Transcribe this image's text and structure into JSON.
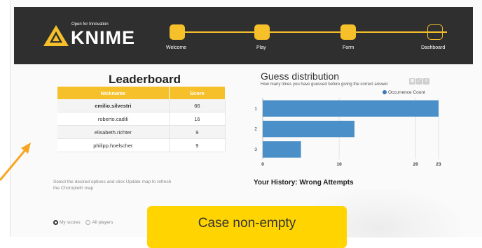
{
  "header": {
    "logo_tagline": "Open for Innovation",
    "logo_wordmark": "KNIME",
    "steps": [
      {
        "label": "Welcome",
        "state": "completed"
      },
      {
        "label": "Play",
        "state": "completed"
      },
      {
        "label": "Form",
        "state": "completed"
      },
      {
        "label": "Dashboard",
        "state": "current"
      }
    ]
  },
  "leaderboard": {
    "title": "Leaderboard",
    "columns": [
      "Nickname",
      "Score"
    ],
    "rows": [
      {
        "nickname": "emilio.silvestri",
        "score": "66"
      },
      {
        "nickname": "roberto.cadili",
        "score": "16"
      },
      {
        "nickname": "elisabeth.richter",
        "score": "9"
      },
      {
        "nickname": "philipp.hoelscher",
        "score": "9"
      }
    ]
  },
  "map_controls": {
    "hint": "Select the desired options and click Update map to refresh the Choropleth map",
    "options": [
      "My scores",
      "All players"
    ],
    "selected": "My scores"
  },
  "guess_distribution": {
    "title": "Guess distribution",
    "subtitle": "How many times you have guessed before giving the correct answer",
    "legend": "Occurrence Count"
  },
  "chart_data": {
    "type": "bar",
    "orientation": "horizontal",
    "categories": [
      "1",
      "2",
      "3"
    ],
    "series": [
      {
        "name": "Occurrence Count",
        "values": [
          23,
          12,
          5
        ]
      }
    ],
    "xlim": [
      0,
      23
    ],
    "xticks": [
      "0",
      "10",
      "20",
      "23"
    ],
    "grid": true,
    "legend_position": "top-right",
    "bar_color": "#4a8fc7"
  },
  "history": {
    "title": "Your History: Wrong Attempts"
  },
  "callout": {
    "text": "Case non-empty"
  },
  "colors": {
    "accent": "#f6c02b",
    "header_bg": "#2f2f2f",
    "callout": "#ffd400",
    "arrow": "#f6a623"
  }
}
